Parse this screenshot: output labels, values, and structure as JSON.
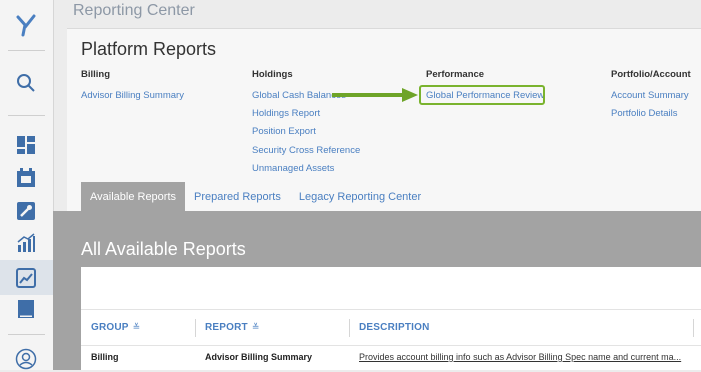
{
  "app": {
    "title": "Reporting Center"
  },
  "platform": {
    "title": "Platform Reports",
    "columns": [
      {
        "heading": "Billing",
        "links": [
          "Advisor Billing Summary"
        ]
      },
      {
        "heading": "Holdings",
        "links": [
          "Global Cash Balances",
          "Holdings Report",
          "Position Export",
          "Security Cross Reference",
          "Unmanaged Assets"
        ]
      },
      {
        "heading": "Performance",
        "links": [
          "Global Performance Review"
        ]
      },
      {
        "heading": "Portfolio/Account",
        "links": [
          "Account Summary",
          "Portfolio Details"
        ]
      }
    ]
  },
  "tabs": [
    "Available Reports",
    "Prepared Reports",
    "Legacy Reporting Center"
  ],
  "available": {
    "title": "All Available Reports",
    "columns": [
      "GROUP",
      "REPORT",
      "DESCRIPTION"
    ],
    "rows": [
      {
        "group": "Billing",
        "report": "Advisor Billing Summary",
        "description": "Provides account billing info such as Advisor Billing Spec name and current ma..."
      }
    ]
  },
  "colors": {
    "accent": "#4a7fc1",
    "highlight": "#7ab32e",
    "band": "#a3a3a3"
  }
}
